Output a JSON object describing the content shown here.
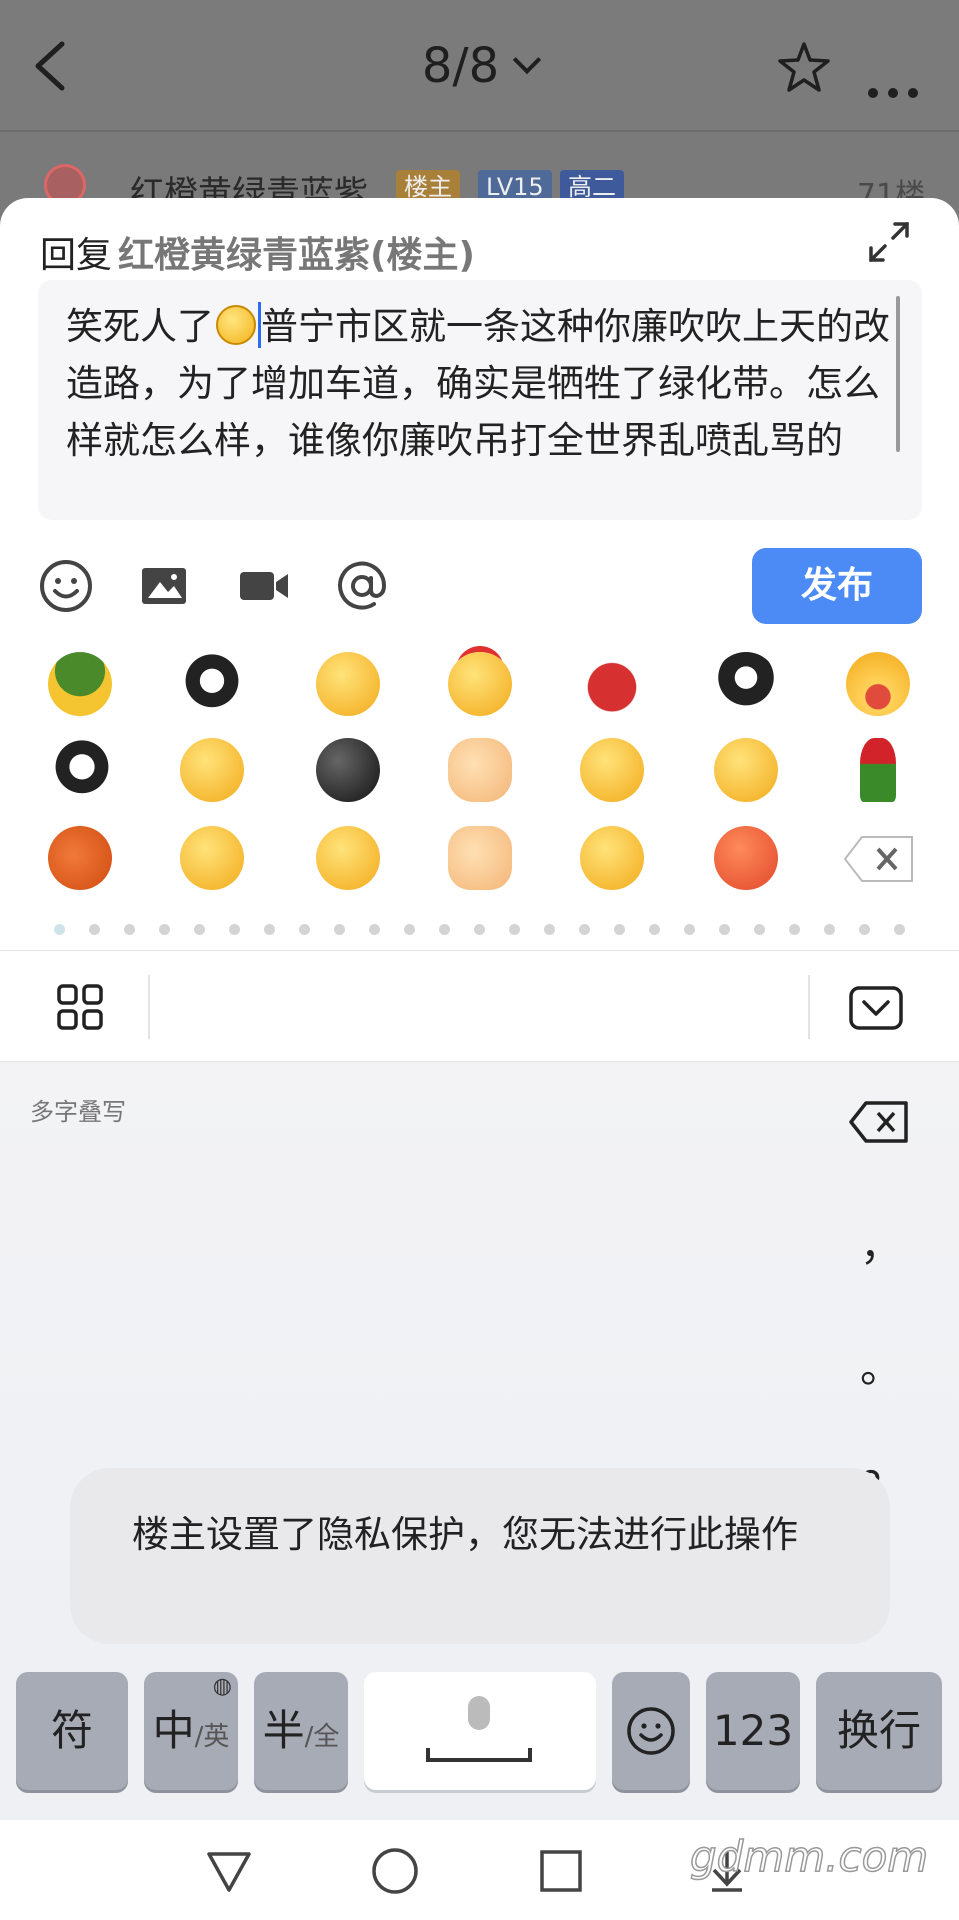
{
  "header": {
    "page_indicator": "8/8",
    "user_name": "红橙黄绿青蓝紫",
    "tags": [
      "楼主",
      "LV15",
      "高二"
    ],
    "floor": "71楼"
  },
  "reply": {
    "prefix": "回复",
    "target": "红橙黄绿青蓝紫(楼主)",
    "text_before": "笑死人了",
    "text_after": "普宁市区就一条这种你廉吹吹上天的改造路，为了增加车道，确实是牺牲了绿化带。怎么样就怎么样，谁像你廉吹吊打全世界乱喷乱骂的",
    "publish_label": "发布"
  },
  "emoji_panel": {
    "rows": [
      [
        "turtle",
        "penguin-small",
        "facepalm",
        "666",
        "ladybug",
        "penguin-cry",
        "watermelon"
      ],
      [
        "penguin",
        "wave",
        "bomb",
        "ok-hand",
        "grin",
        "think",
        "rose"
      ],
      [
        "ping-pong",
        "shy",
        "cute",
        "fist",
        "giggle",
        "angry",
        "delete"
      ]
    ],
    "pages": 25,
    "active_page": 0
  },
  "keyboard": {
    "mode_label": "多字叠写",
    "punctuation": [
      "，",
      "。",
      "？",
      "！"
    ],
    "keys": {
      "symbol": "符",
      "lang_main": "中",
      "lang_sub": "/英",
      "width_main": "半",
      "width_sub": "/全",
      "numbers": "123",
      "enter": "换行"
    }
  },
  "toast": {
    "message": "楼主设置了隐私保护，您无法进行此操作"
  },
  "watermark": "gdmm.com",
  "colors": {
    "accent": "#4c8bf5",
    "sheet_bg": "#ffffff",
    "key_gray": "#a7abb6"
  }
}
